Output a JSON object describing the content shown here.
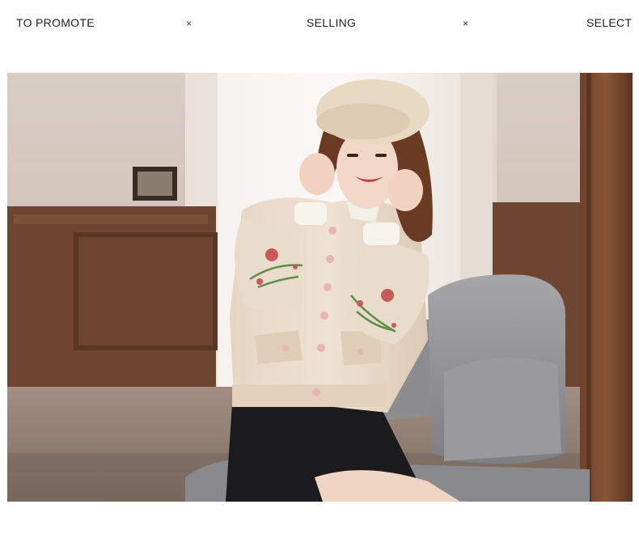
{
  "header": {
    "left_label": "TO PROMOTE",
    "center_label": "SELLING",
    "right_label": "SELECT",
    "separator_1": "×",
    "separator_2": "×"
  },
  "photo": {
    "subject": "photo-woman-embroidered-jacket"
  }
}
